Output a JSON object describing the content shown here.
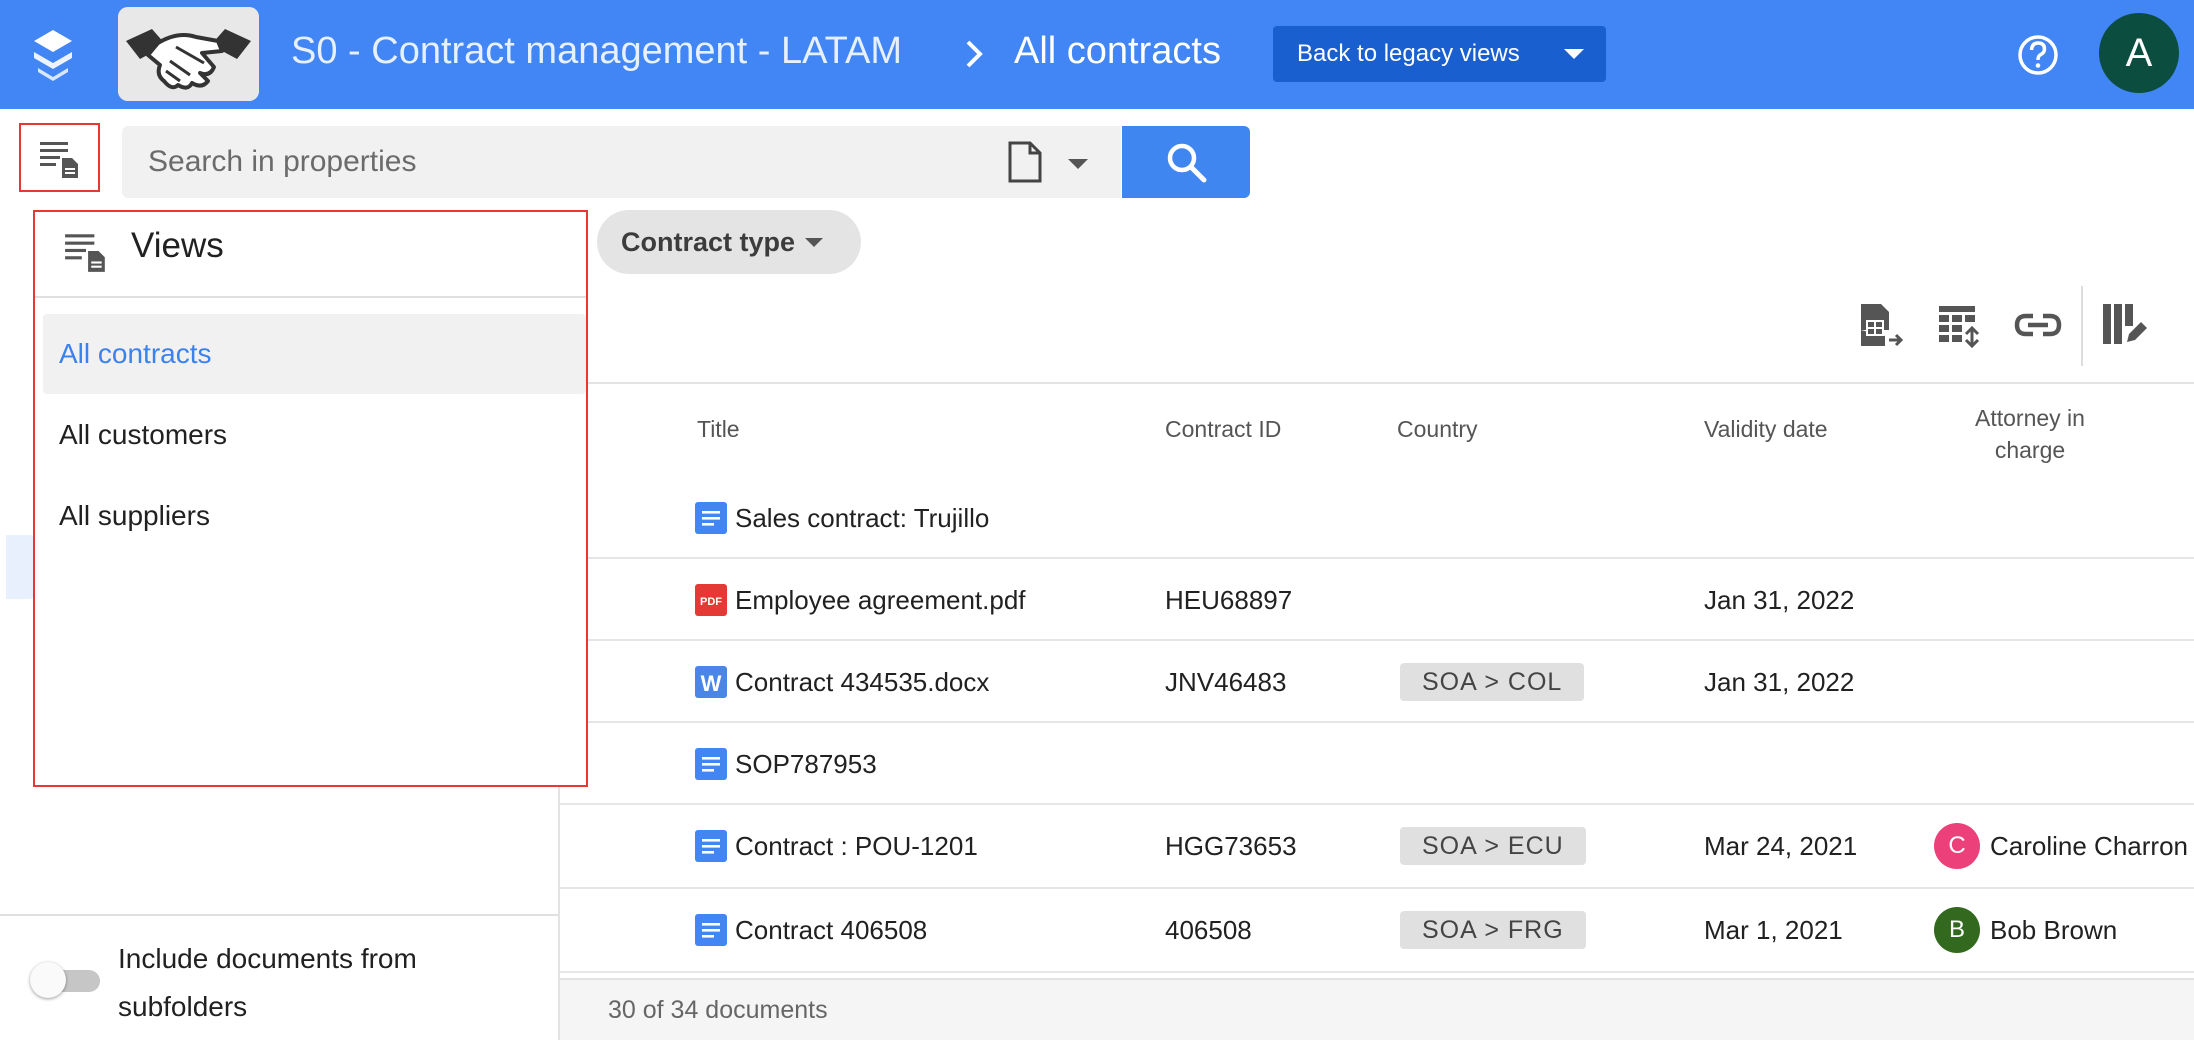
{
  "header": {
    "breadcrumb_space": "S0 - Contract management - LATAM",
    "breadcrumb_current": "All contracts",
    "legacy_button": "Back to legacy views",
    "avatar_initial": "A",
    "brand_color": "#4285f4"
  },
  "search": {
    "placeholder": "Search in properties",
    "value": ""
  },
  "filters": {
    "contract_type_label": "Contract type"
  },
  "table": {
    "columns": {
      "title": "Title",
      "contract_id": "Contract ID",
      "country": "Country",
      "validity_date": "Validity date",
      "attorney_line1": "Attorney in",
      "attorney_line2": "charge"
    },
    "rows": [
      {
        "icon": "doc-icon",
        "title": "Sales contract: Trujillo",
        "contract_id": "",
        "country": "",
        "validity_date": "",
        "attorney": "",
        "attorney_initial": ""
      },
      {
        "icon": "pdf-icon",
        "title": "Employee agreement.pdf",
        "contract_id": "HEU68897",
        "country": "",
        "validity_date": "Jan 31, 2022",
        "attorney": "",
        "attorney_initial": ""
      },
      {
        "icon": "word-icon",
        "title": "Contract 434535.docx",
        "contract_id": "JNV46483",
        "country": "SOA  >  COL",
        "validity_date": "Jan 31, 2022",
        "attorney": "",
        "attorney_initial": ""
      },
      {
        "icon": "doc-icon",
        "title": "SOP787953",
        "contract_id": "",
        "country": "",
        "validity_date": "",
        "attorney": "",
        "attorney_initial": ""
      },
      {
        "icon": "doc-icon",
        "title": "Contract : POU-1201",
        "contract_id": "HGG73653",
        "country": "SOA  >  ECU",
        "validity_date": "Mar 24, 2021",
        "attorney": "Caroline Charron",
        "attorney_initial": "C",
        "avatar_color": "#ec407a"
      },
      {
        "icon": "doc-icon",
        "title": "Contract 406508",
        "contract_id": "406508",
        "country": "SOA  >  FRG",
        "validity_date": "Mar 1, 2021",
        "attorney": "Bob Brown",
        "attorney_initial": "B",
        "avatar_color": "#33691e"
      }
    ],
    "count_text": "30 of 34 documents"
  },
  "views_panel": {
    "title": "Views",
    "items": [
      {
        "label": "All contracts",
        "active": true
      },
      {
        "label": "All customers",
        "active": false
      },
      {
        "label": "All suppliers",
        "active": false
      }
    ]
  },
  "sidebar": {
    "include_subfolders_label": "Include documents from subfolders"
  },
  "icons": {
    "views_toggle": "views-list-icon",
    "document_type": "document-icon",
    "search": "search-icon",
    "actions": [
      "export-spreadsheet-icon",
      "import-table-icon",
      "link-icon",
      "edit-columns-icon"
    ],
    "help": "help-icon"
  }
}
